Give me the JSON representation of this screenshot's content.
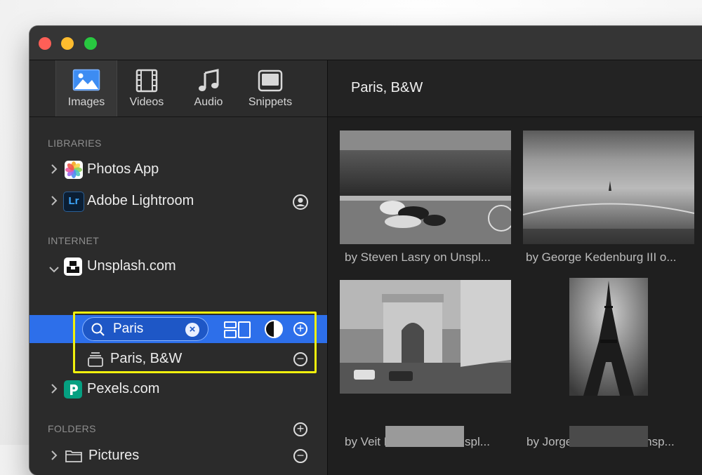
{
  "tabs": [
    {
      "label": "Images",
      "icon": "image-icon",
      "active": true
    },
    {
      "label": "Videos",
      "icon": "film-icon",
      "active": false
    },
    {
      "label": "Audio",
      "icon": "music-note-icon",
      "active": false
    },
    {
      "label": "Snippets",
      "icon": "snippet-icon",
      "active": false
    }
  ],
  "sidebar": {
    "libraries_header": "LIBRARIES",
    "internet_header": "INTERNET",
    "folders_header": "FOLDERS",
    "photos_app": "Photos App",
    "lightroom_badge": "Lr",
    "lightroom": "Adobe Lightroom",
    "unsplash": "Unsplash.com",
    "search_value": "Paris",
    "saved_search": "Paris, B&W",
    "pexels": "Pexels.com",
    "pictures": "Pictures"
  },
  "content": {
    "title": "Paris, B&W",
    "items": [
      {
        "caption": "by Steven Lasry on Unspl..."
      },
      {
        "caption": "by George Kedenburg III o..."
      },
      {
        "caption": "by Veit Hammer on Unspl..."
      },
      {
        "caption": "by Jorge Gascón on Unsp..."
      }
    ]
  },
  "colors": {
    "accent": "#2d6fea",
    "highlight": "#f1f00d",
    "window_bg": "#1e1e1e",
    "sidebar_bg": "#2b2b2b"
  }
}
